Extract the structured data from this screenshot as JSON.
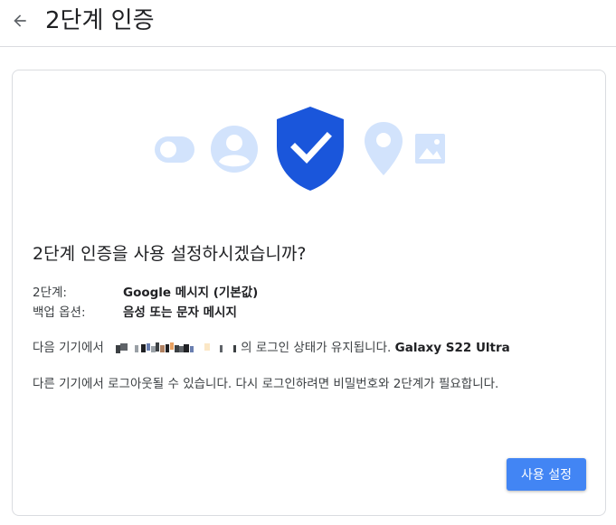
{
  "header": {
    "title": "2단계 인증",
    "back_icon": "arrow-left-icon"
  },
  "card": {
    "question": "2단계 인증을 사용 설정하시겠습니까?",
    "info": [
      {
        "label": "2단계:",
        "value": "Google 메시지 (기본값)"
      },
      {
        "label": "백업 옵션:",
        "value": "음성 또는 문자 메시지"
      }
    ],
    "device_prefix": "다음 기기에서",
    "device_suffix": "의 로그인 상태가 유지됩니다.",
    "device_name": "Galaxy S22 Ultra",
    "notice": "다른 기기에서 로그아웃될 수 있습니다. 다시 로그인하려면 비밀번호와 2단계가 필요합니다.",
    "setup_button": "사용 설정"
  },
  "colors": {
    "accent": "#4285f4",
    "shield": "#1a56db",
    "illustration_light": "#d2e3fc"
  }
}
